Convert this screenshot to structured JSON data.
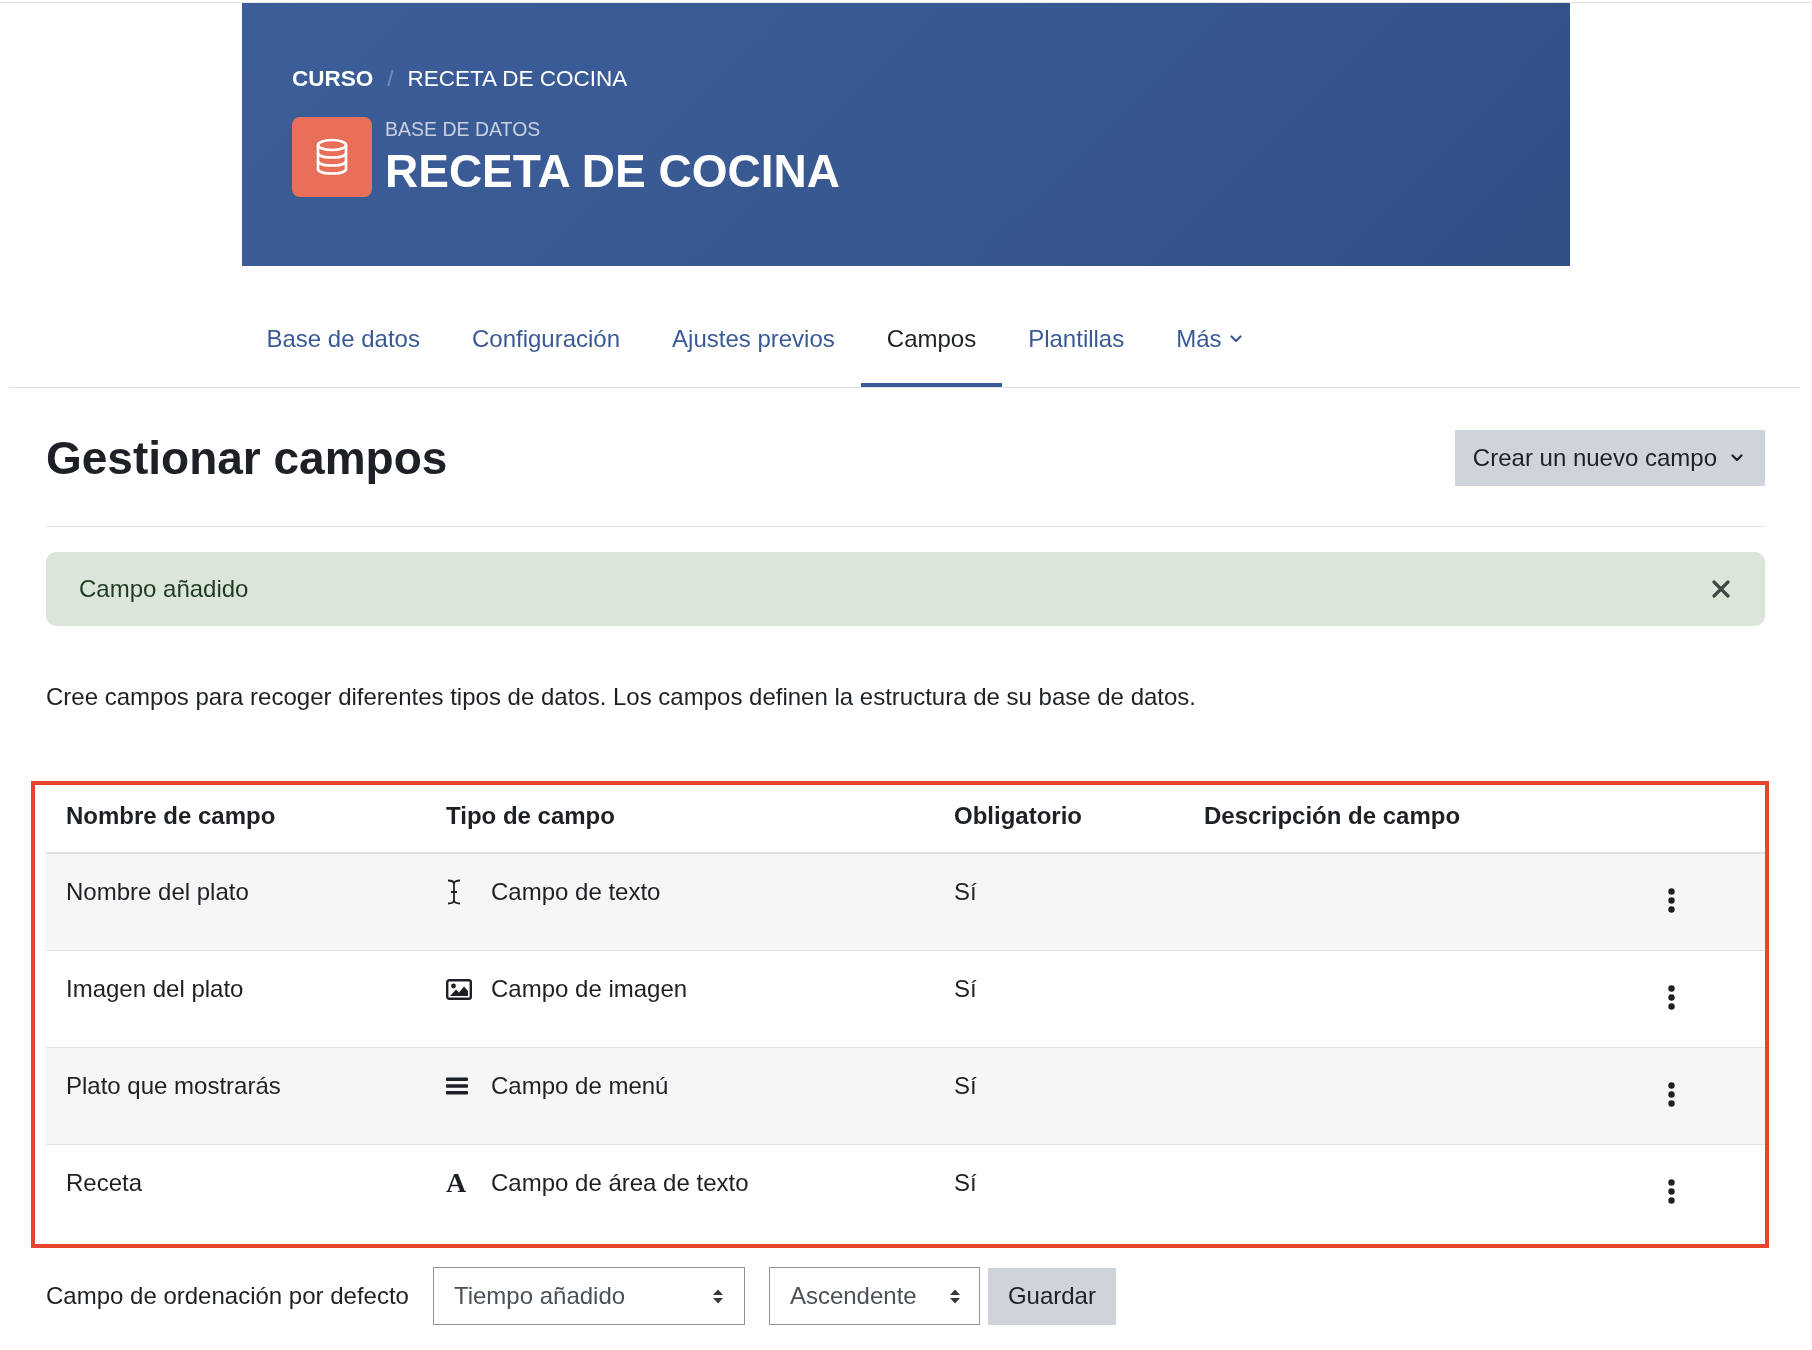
{
  "header": {
    "breadcrumb": [
      {
        "label": "CURSO",
        "kind": "link"
      },
      {
        "label": "RECETA DE COCINA",
        "kind": "current"
      }
    ],
    "breadcrumb_separator": "/",
    "activity_type": "BASE DE DATOS",
    "title": "RECETA DE COCINA"
  },
  "tabs": [
    {
      "label": "Base de datos",
      "selected": false,
      "dropdown": false
    },
    {
      "label": "Configuración",
      "selected": false,
      "dropdown": false
    },
    {
      "label": "Ajustes previos",
      "selected": false,
      "dropdown": false
    },
    {
      "label": "Campos",
      "selected": true,
      "dropdown": false
    },
    {
      "label": "Plantillas",
      "selected": false,
      "dropdown": false
    },
    {
      "label": "Más",
      "selected": false,
      "dropdown": true
    }
  ],
  "page_title": "Gestionar campos",
  "create_button": {
    "label": "Crear un nuevo campo",
    "dropdown": true
  },
  "alert": {
    "message": "Campo añadido",
    "dismissible": true
  },
  "intro": "Cree campos para recoger diferentes tipos de datos. Los campos definen la estructura de su base de datos.",
  "fields_table": {
    "highlighted": true,
    "columns": [
      "Nombre de campo",
      "Tipo de campo",
      "Obligatorio",
      "Descripción de campo"
    ],
    "rows": [
      {
        "name": "Nombre del plato",
        "type": {
          "kind": "text",
          "label": "Campo de texto"
        },
        "required": "Sí"
      },
      {
        "name": "Imagen del plato",
        "type": {
          "kind": "image",
          "label": "Campo de imagen"
        },
        "required": "Sí"
      },
      {
        "name": "Plato que mostrarás",
        "type": {
          "kind": "menu",
          "label": "Campo de menú"
        },
        "required": "Sí"
      },
      {
        "name": "Receta",
        "type": {
          "kind": "textarea",
          "icon_char": "A",
          "label": "Campo de área de texto"
        },
        "required": "Sí"
      }
    ]
  },
  "default_sort": {
    "label": "Campo de ordenación por defecto",
    "field": {
      "value": "Tiempo añadido"
    },
    "order": {
      "value": "Ascendente"
    },
    "save_button": "Guardar"
  }
}
